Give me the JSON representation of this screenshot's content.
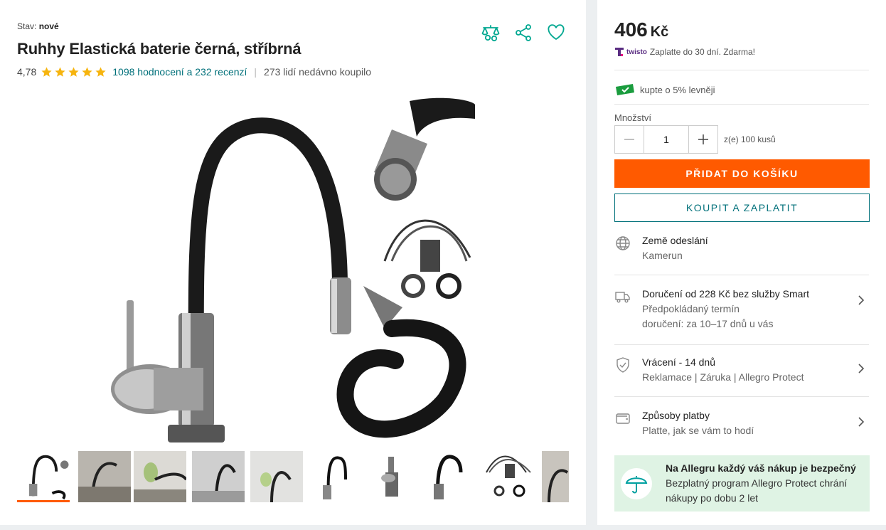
{
  "product": {
    "condition_label": "Stav:",
    "condition_value": "nové",
    "title": "Ruhhy Elastická baterie černá, stříbrná",
    "rating_value": "4,78",
    "stars": 5,
    "reviews_link": "1098 hodnocení a 232 recenzí",
    "separator": "|",
    "bought_recently": "273 lidí nedávno koupilo"
  },
  "actions": {
    "compare_icon": "scales-icon",
    "share_icon": "share-icon",
    "favorite_icon": "heart-icon"
  },
  "gallery": {
    "active_index": 0,
    "thumbnail_count": 10
  },
  "buy_box": {
    "price": "406",
    "currency": "Kč",
    "twisto_brand": "twisto",
    "twisto_text": "Zaplatte do 30 dní. Zdarma!",
    "discount_text": "kupte o 5% levněji",
    "quantity_label": "Množství",
    "quantity_value": "1",
    "quantity_of": "z(e) 100 kusů",
    "add_to_cart": "PŘIDAT DO KOŠÍKU",
    "buy_now": "KOUPIT A ZAPLATIT"
  },
  "info_rows": [
    {
      "icon": "globe-icon",
      "title": "Země odeslání",
      "sub": "Kamerun"
    },
    {
      "icon": "truck-icon",
      "title": "Doručení od 228 Kč bez služby Smart",
      "sub": "Předpokládaný termín",
      "sub2": "doručení: za 10–17 dnů u vás"
    },
    {
      "icon": "shield-icon",
      "title": "Vrácení - 14 dnů",
      "sub": "Reklamace | Záruka | Allegro Protect"
    },
    {
      "icon": "wallet-icon",
      "title": "Způsoby platby",
      "sub": "Platte, jak se vám to hodí"
    }
  ],
  "protect": {
    "title": "Na Allegru každý váš nákup je bezpečný",
    "text1": "Bezplatný program Allegro Protect chrání",
    "text2": "nákupy po dobu 2 let"
  },
  "colors": {
    "accent_orange": "#ff5a00",
    "teal": "#00707a",
    "star": "#f6b40e",
    "protect_bg": "#dff3e4"
  }
}
